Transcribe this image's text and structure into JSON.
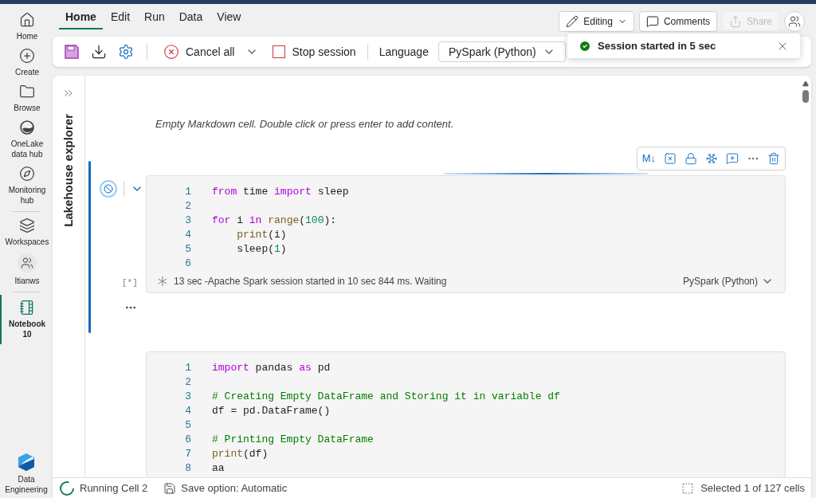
{
  "sidebar": {
    "items": [
      {
        "label": "Home",
        "selected": false
      },
      {
        "label": "Create",
        "selected": false
      },
      {
        "label": "Browse",
        "selected": false
      },
      {
        "label": "OneLake data hub",
        "selected": false
      },
      {
        "label": "Monitoring hub",
        "selected": false
      },
      {
        "label": "Workspaces",
        "selected": false
      },
      {
        "label": "Itianws",
        "selected": false
      },
      {
        "label": "Notebook 10",
        "selected": true
      }
    ],
    "footer": {
      "label": "Data Engineering"
    }
  },
  "tabs": [
    {
      "label": "Home",
      "selected": true
    },
    {
      "label": "Edit",
      "selected": false
    },
    {
      "label": "Run",
      "selected": false
    },
    {
      "label": "Data",
      "selected": false
    },
    {
      "label": "View",
      "selected": false
    }
  ],
  "top_buttons": [
    {
      "label": "Editing",
      "kind": "edit",
      "disabled": false
    },
    {
      "label": "Comments",
      "kind": "comments",
      "disabled": false
    },
    {
      "label": "Share",
      "kind": "share",
      "disabled": true
    }
  ],
  "toolbar": {
    "cancel": "Cancel all",
    "stop": "Stop session",
    "language_label": "Language",
    "language": "PySpark (Python)"
  },
  "toast": {
    "message": "Session started in 5 sec"
  },
  "explorer": {
    "title": "Lakehouse explorer"
  },
  "markdown_hint": "Empty Markdown cell. Double click or press enter to add content.",
  "cell_toolbar": {
    "markdown": "M↓"
  },
  "cells": [
    {
      "selected": true,
      "running": true,
      "count": "[*]",
      "status": "13 sec -Apache Spark session started in 10 sec 844 ms. Waiting",
      "language": "PySpark (Python)",
      "lines": [
        {
          "number": "1",
          "tokens": [
            {
              "kind": "keyword",
              "text": "from"
            },
            {
              "kind": "plain",
              "text": " time "
            },
            {
              "kind": "keyword",
              "text": "import"
            },
            {
              "kind": "plain",
              "text": " sleep"
            }
          ]
        },
        {
          "number": "2"
        },
        {
          "number": "3",
          "tokens": [
            {
              "kind": "keyword",
              "text": "for"
            },
            {
              "kind": "plain",
              "text": " i "
            },
            {
              "kind": "keyword",
              "text": "in"
            },
            {
              "kind": "function",
              "text": " range"
            },
            {
              "kind": "plain",
              "text": "("
            },
            {
              "kind": "number",
              "text": "100"
            },
            {
              "kind": "plain",
              "text": "):"
            }
          ]
        },
        {
          "number": "4",
          "tokens": [
            {
              "kind": "function",
              "text": "    print"
            },
            {
              "kind": "plain",
              "text": "(i)"
            }
          ]
        },
        {
          "number": "5",
          "tokens": [
            {
              "kind": "plain",
              "text": "    sleep("
            },
            {
              "kind": "number",
              "text": "1"
            },
            {
              "kind": "plain",
              "text": ")"
            }
          ]
        },
        {
          "number": "6"
        }
      ]
    },
    {
      "selected": false,
      "running": false,
      "lines": [
        {
          "number": "1",
          "tokens": [
            {
              "kind": "keyword",
              "text": "import"
            },
            {
              "kind": "plain",
              "text": " pandas "
            },
            {
              "kind": "keyword",
              "text": "as"
            },
            {
              "kind": "plain",
              "text": " pd"
            }
          ]
        },
        {
          "number": "2"
        },
        {
          "number": "3",
          "tokens": [
            {
              "kind": "comment",
              "text": "# Creating Empty DataFrame and Storing it in variable df"
            }
          ]
        },
        {
          "number": "4",
          "tokens": [
            {
              "kind": "plain",
              "text": "df = pd.DataFrame()"
            }
          ]
        },
        {
          "number": "5"
        },
        {
          "number": "6",
          "tokens": [
            {
              "kind": "comment",
              "text": "# Printing Empty DataFrame"
            }
          ]
        },
        {
          "number": "7",
          "tokens": [
            {
              "kind": "function",
              "text": "print"
            },
            {
              "kind": "plain",
              "text": "(df)"
            }
          ]
        },
        {
          "number": "8",
          "tokens": [
            {
              "kind": "plain",
              "text": "aa"
            }
          ]
        }
      ]
    }
  ],
  "status_bar": {
    "running": "Running Cell 2",
    "save": "Save option: Automatic",
    "selection": "Selected 1 of 127 cells"
  }
}
